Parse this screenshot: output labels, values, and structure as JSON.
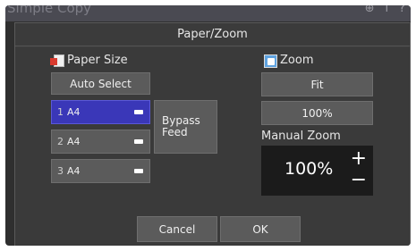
{
  "app": {
    "title": "Simple Copy"
  },
  "top_icons": [
    {
      "name": "globe-icon",
      "glyph": "⊕"
    },
    {
      "name": "info-icon",
      "glyph": "i"
    },
    {
      "name": "help-icon",
      "glyph": "?"
    }
  ],
  "dialog": {
    "title": "Paper/Zoom"
  },
  "paper_size": {
    "label": "Paper Size",
    "auto_select": "Auto Select",
    "trays": [
      {
        "number": "1",
        "size": "A4",
        "selected": true
      },
      {
        "number": "2",
        "size": "A4",
        "selected": false
      },
      {
        "number": "3",
        "size": "A4",
        "selected": false
      }
    ],
    "bypass_line1": "Bypass",
    "bypass_line2": "Feed"
  },
  "zoom": {
    "label": "Zoom",
    "fit": "Fit",
    "preset": "100%",
    "manual_label": "Manual Zoom",
    "value": "100%",
    "plus": "+",
    "minus": "−"
  },
  "footer": {
    "cancel": "Cancel",
    "ok": "OK"
  },
  "colors": {
    "selected_tray": "#3a37b8",
    "button": "#5b5b5b",
    "dialog_bg": "#3a3a3a"
  }
}
